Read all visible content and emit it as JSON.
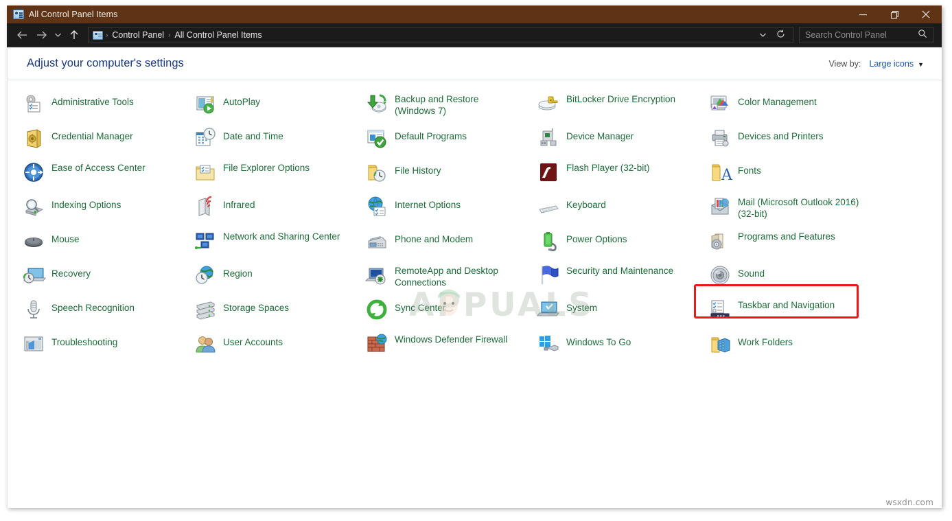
{
  "window": {
    "title": "All Control Panel Items",
    "title_icon": "control-panel-icon",
    "titlebar_color": "#5e3316",
    "controls": {
      "minimize": "minimize-icon",
      "maximize": "restore-icon",
      "close": "close-icon"
    }
  },
  "navbar": {
    "back": "back-arrow-icon",
    "forward": "forward-arrow-icon",
    "recent": "chevron-down-icon",
    "up": "up-arrow-icon",
    "breadcrumb": [
      "Control Panel",
      "All Control Panel Items"
    ],
    "breadcrumb_separator": "›",
    "dropdown": "chevron-down-icon",
    "refresh": "refresh-icon",
    "search": {
      "placeholder": "Search Control Panel",
      "value": "",
      "icon": "search-icon"
    }
  },
  "header": {
    "page_title": "Adjust your computer's settings",
    "view_by_label": "View by:",
    "view_by_value": "Large icons",
    "view_by_caret": "▼",
    "title_color": "#1b3a77",
    "link_color": "#1a56b0"
  },
  "grid": {
    "link_color": "#1f6b3a",
    "columns": 5,
    "items": [
      {
        "label": "Administrative Tools",
        "icon": "administrative-tools-icon",
        "col": 1,
        "row": 1
      },
      {
        "label": "AutoPlay",
        "icon": "autoplay-icon",
        "col": 2,
        "row": 1
      },
      {
        "label": "Backup and Restore (Windows 7)",
        "icon": "backup-restore-icon",
        "col": 3,
        "row": 1
      },
      {
        "label": "BitLocker Drive Encryption",
        "icon": "bitlocker-icon",
        "col": 4,
        "row": 1
      },
      {
        "label": "Color Management",
        "icon": "color-management-icon",
        "col": 5,
        "row": 1
      },
      {
        "label": "Credential Manager",
        "icon": "credential-manager-icon",
        "col": 1,
        "row": 2
      },
      {
        "label": "Date and Time",
        "icon": "date-time-icon",
        "col": 2,
        "row": 2
      },
      {
        "label": "Default Programs",
        "icon": "default-programs-icon",
        "col": 3,
        "row": 2
      },
      {
        "label": "Device Manager",
        "icon": "device-manager-icon",
        "col": 4,
        "row": 2
      },
      {
        "label": "Devices and Printers",
        "icon": "devices-printers-icon",
        "col": 5,
        "row": 2
      },
      {
        "label": "Ease of Access Center",
        "icon": "ease-of-access-icon",
        "col": 1,
        "row": 3
      },
      {
        "label": "File Explorer Options",
        "icon": "file-explorer-options-icon",
        "col": 2,
        "row": 3
      },
      {
        "label": "File History",
        "icon": "file-history-icon",
        "col": 3,
        "row": 3
      },
      {
        "label": "Flash Player (32-bit)",
        "icon": "flash-player-icon",
        "col": 4,
        "row": 3
      },
      {
        "label": "Fonts",
        "icon": "fonts-icon",
        "col": 5,
        "row": 3
      },
      {
        "label": "Indexing Options",
        "icon": "indexing-options-icon",
        "col": 1,
        "row": 4
      },
      {
        "label": "Infrared",
        "icon": "infrared-icon",
        "col": 2,
        "row": 4
      },
      {
        "label": "Internet Options",
        "icon": "internet-options-icon",
        "col": 3,
        "row": 4
      },
      {
        "label": "Keyboard",
        "icon": "keyboard-icon",
        "col": 4,
        "row": 4
      },
      {
        "label": "Mail (Microsoft Outlook 2016) (32-bit)",
        "icon": "mail-icon",
        "col": 5,
        "row": 4
      },
      {
        "label": "Mouse",
        "icon": "mouse-icon",
        "col": 1,
        "row": 5
      },
      {
        "label": "Network and Sharing Center",
        "icon": "network-sharing-icon",
        "col": 2,
        "row": 5
      },
      {
        "label": "Phone and Modem",
        "icon": "phone-modem-icon",
        "col": 3,
        "row": 5
      },
      {
        "label": "Power Options",
        "icon": "power-options-icon",
        "col": 4,
        "row": 5
      },
      {
        "label": "Programs and Features",
        "icon": "programs-features-icon",
        "col": 5,
        "row": 5,
        "highlighted": true
      },
      {
        "label": "Recovery",
        "icon": "recovery-icon",
        "col": 1,
        "row": 6
      },
      {
        "label": "Region",
        "icon": "region-icon",
        "col": 2,
        "row": 6
      },
      {
        "label": "RemoteApp and Desktop Connections",
        "icon": "remoteapp-icon",
        "col": 3,
        "row": 6
      },
      {
        "label": "Security and Maintenance",
        "icon": "security-maintenance-icon",
        "col": 4,
        "row": 6
      },
      {
        "label": "Sound",
        "icon": "sound-icon",
        "col": 5,
        "row": 6
      },
      {
        "label": "Speech Recognition",
        "icon": "speech-recognition-icon",
        "col": 1,
        "row": 7
      },
      {
        "label": "Storage Spaces",
        "icon": "storage-spaces-icon",
        "col": 2,
        "row": 7
      },
      {
        "label": "Sync Center",
        "icon": "sync-center-icon",
        "col": 3,
        "row": 7
      },
      {
        "label": "System",
        "icon": "system-icon",
        "col": 4,
        "row": 7
      },
      {
        "label": "Taskbar and Navigation",
        "icon": "taskbar-navigation-icon",
        "col": 5,
        "row": 7
      },
      {
        "label": "Troubleshooting",
        "icon": "troubleshooting-icon",
        "col": 1,
        "row": 8
      },
      {
        "label": "User Accounts",
        "icon": "user-accounts-icon",
        "col": 2,
        "row": 8
      },
      {
        "label": "Windows Defender Firewall",
        "icon": "windows-defender-firewall-icon",
        "col": 3,
        "row": 8
      },
      {
        "label": "Windows To Go",
        "icon": "windows-to-go-icon",
        "col": 4,
        "row": 8
      },
      {
        "label": "Work Folders",
        "icon": "work-folders-icon",
        "col": 5,
        "row": 8
      }
    ]
  },
  "annotations": {
    "highlight_target": "Programs and Features",
    "highlight_color": "#e8181b"
  },
  "watermarks": {
    "center": "APPUALS",
    "corner": "wsxdn.com"
  }
}
